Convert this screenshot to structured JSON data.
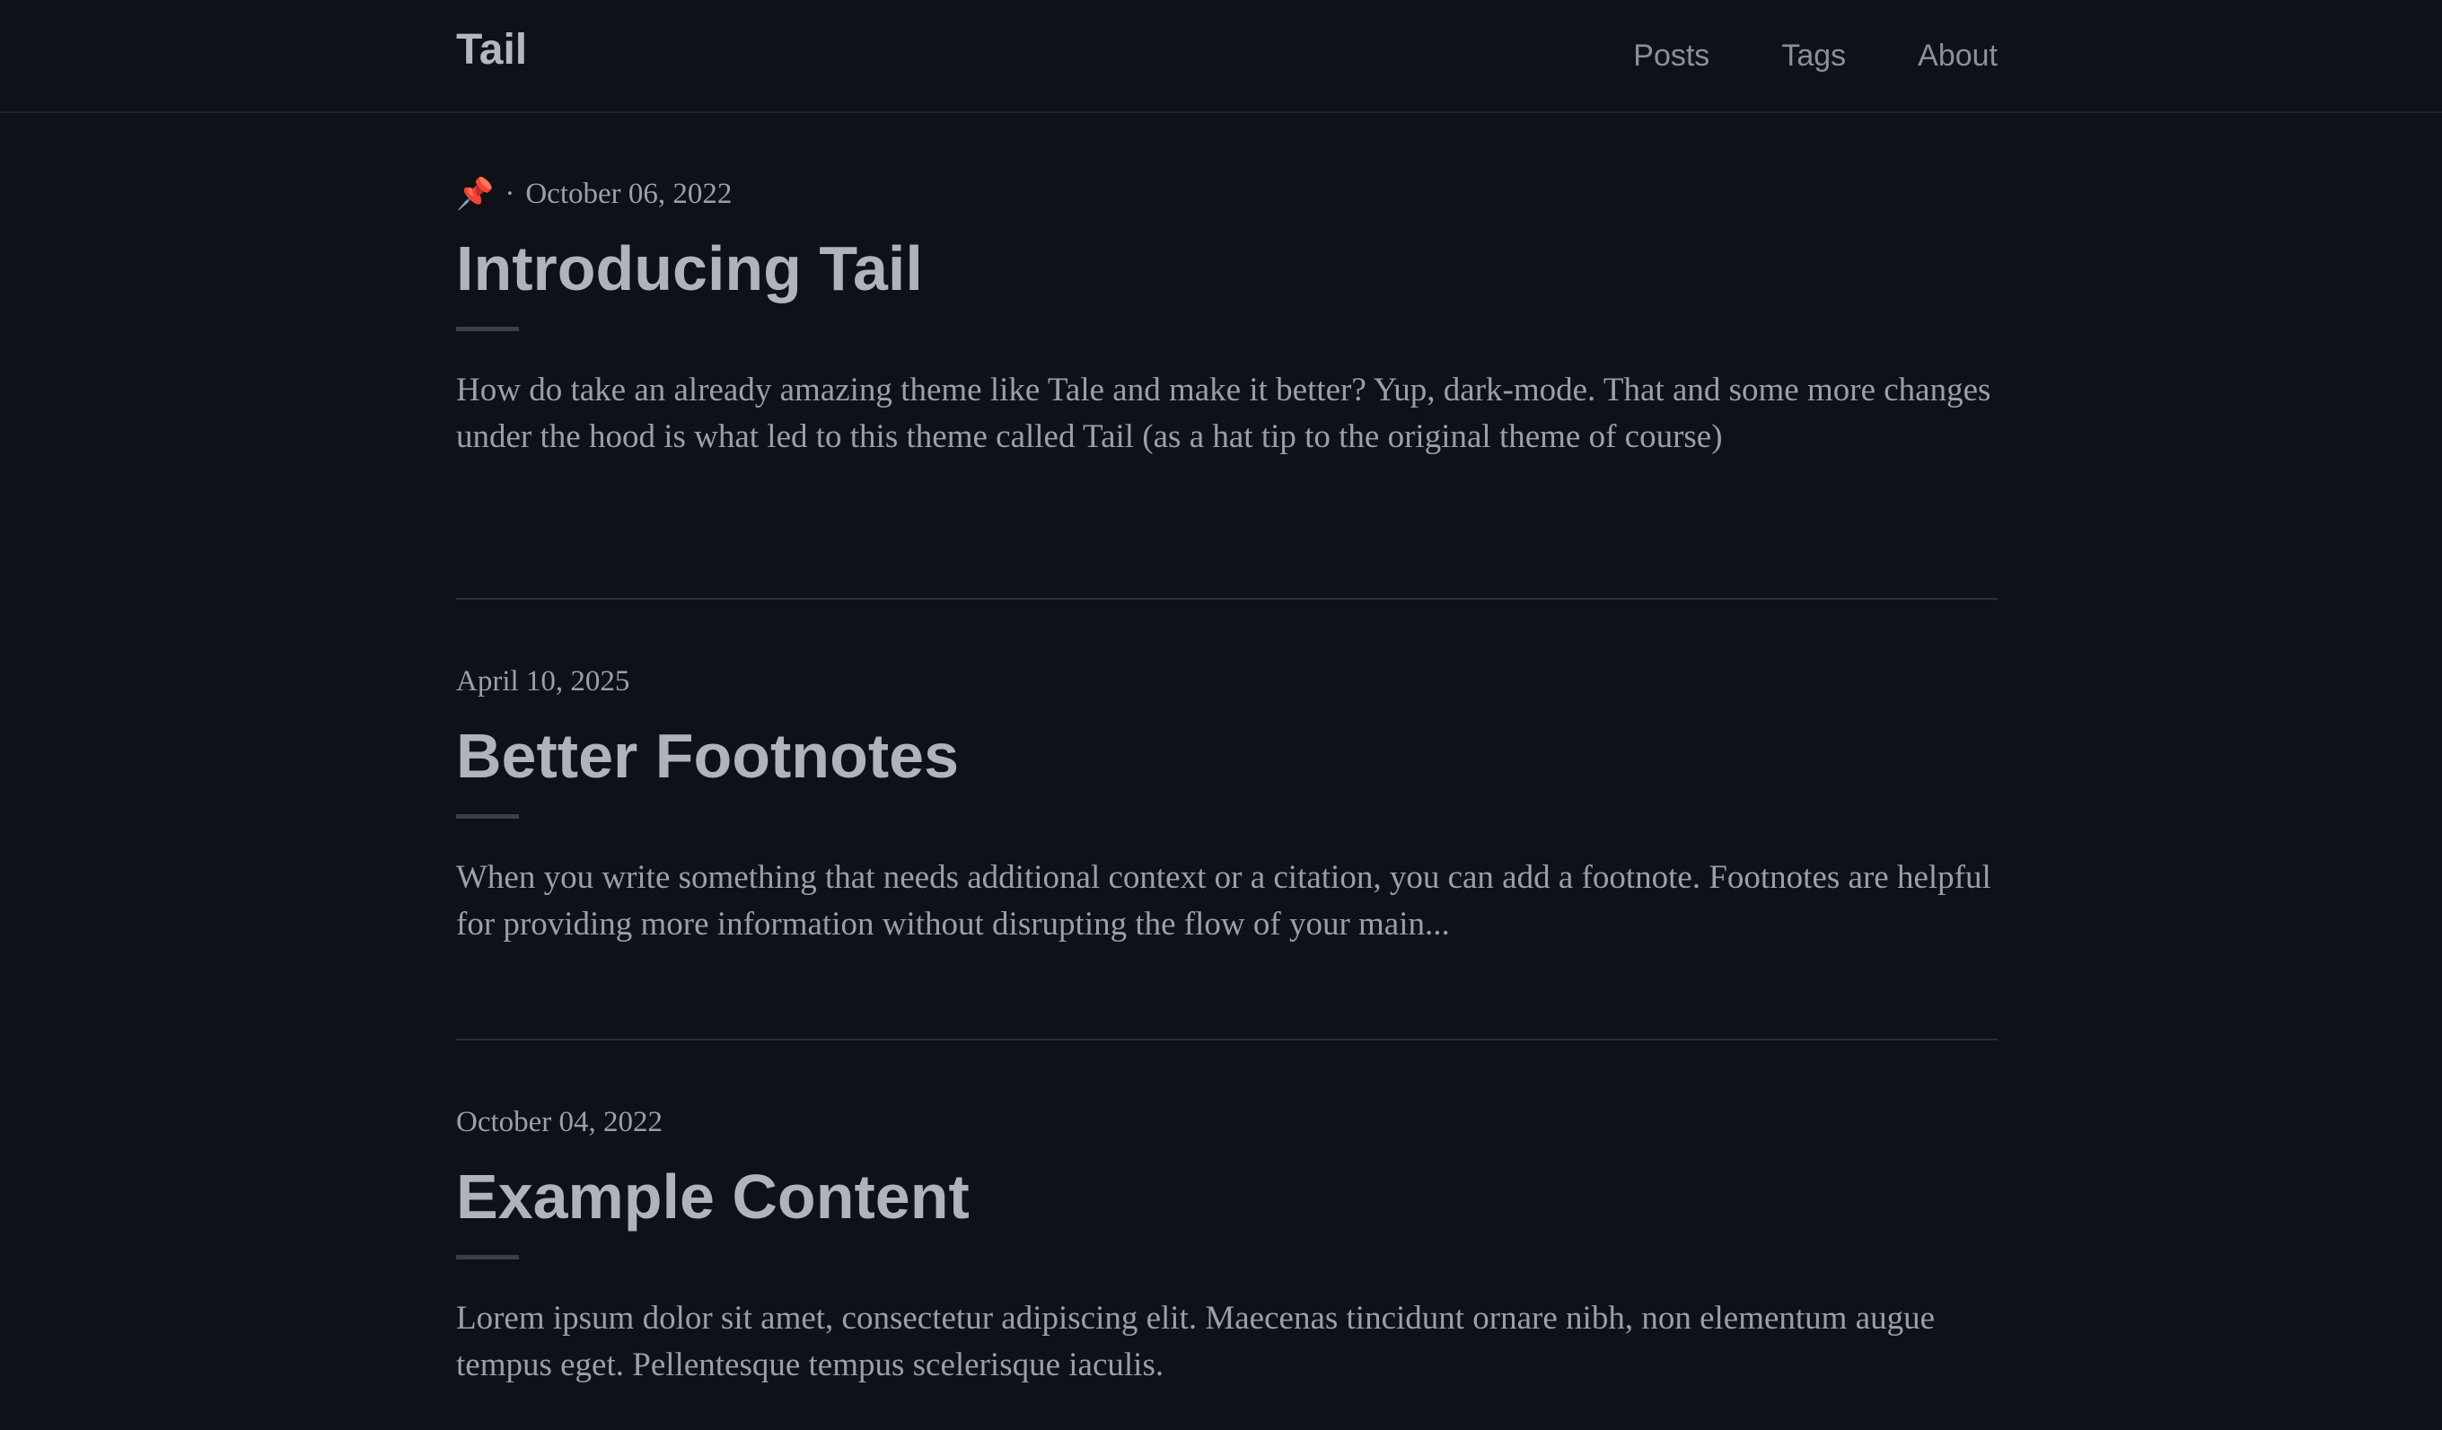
{
  "site": {
    "title": "Tail",
    "nav": [
      "Posts",
      "Tags",
      "About"
    ]
  },
  "posts": [
    {
      "pinned": true,
      "pin_icon": "📌",
      "separator": "·",
      "date": "October 06, 2022",
      "title": "Introducing Tail",
      "excerpt": "How do take an already amazing theme like Tale and make it better? Yup, dark-mode. That and some more changes under the hood is what led to this theme called Tail (as a hat tip to the original theme of course)"
    },
    {
      "pinned": false,
      "date": "April 10, 2025",
      "title": "Better Footnotes",
      "excerpt": "When you write something that needs additional context or a citation, you can add a footnote. Footnotes are helpful for providing more information without disrupting the flow of your main..."
    },
    {
      "pinned": false,
      "date": "October 04, 2022",
      "title": "Example Content",
      "excerpt": "Lorem ipsum dolor sit amet, consectetur adipiscing elit. Maecenas tincidunt ornare nibh, non elementum augue tempus eget. Pellentesque tempus scelerisque iaculis."
    }
  ],
  "colors": {
    "background": "#0e1117",
    "text": "#9aa0a8",
    "title": "#aeb4bb",
    "divider": "#2a2f36"
  }
}
